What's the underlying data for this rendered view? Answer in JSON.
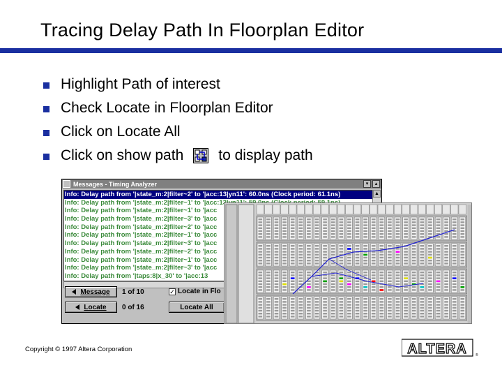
{
  "slide": {
    "title": "Tracing Delay Path In Floorplan Editor",
    "bullets": [
      "Highlight Path of interest",
      "Check Locate in Floorplan Editor",
      "Click on Locate All",
      "Click on show path"
    ],
    "bullet4_suffix": "to display path",
    "copyright": "Copyright © 1997 Altera Corporation",
    "logo_text": "ALTERA",
    "accent_color": "#1a2fa0"
  },
  "messages_window": {
    "title": "Messages - Timing Analyzer",
    "rows": [
      "Info: Delay path from '|state_m:2|filter~2' to '|acc:13|yn11': 60.0ns (Clock period: 61.1ns)",
      "Info: Delay path from '|state_m:2|filter~1' to '|acc:13|yn11': 59.0ns (Clock period: 59.1ns)",
      "Info: Delay path from '|state_m:2|filter~1' to '|acc",
      "Info: Delay path from '|state_m:2|filter~3' to '|acc",
      "Info: Delay path from '|state_m:2|filter~2' to '|acc",
      "Info: Delay path from '|state_m:2|filter~1' to '|acc",
      "Info: Delay path from '|state_m:2|filter~3' to '|acc",
      "Info: Delay path from '|state_m:2|filter~2' to '|acc",
      "Info: Delay path from '|state_m:2|filter~1' to '|acc",
      "Info: Delay path from '|state_m:2|filter~3' to '|acc",
      "Info: Delay path from '|taps:8|x_30' to '|acc:13"
    ],
    "message_button": "Message",
    "message_count": "1 of 10",
    "locate_button": "Locate",
    "locate_count": "0 of 16",
    "locate_checkbox_label": "Locate in Flo",
    "locate_all_button": "Locate All"
  }
}
